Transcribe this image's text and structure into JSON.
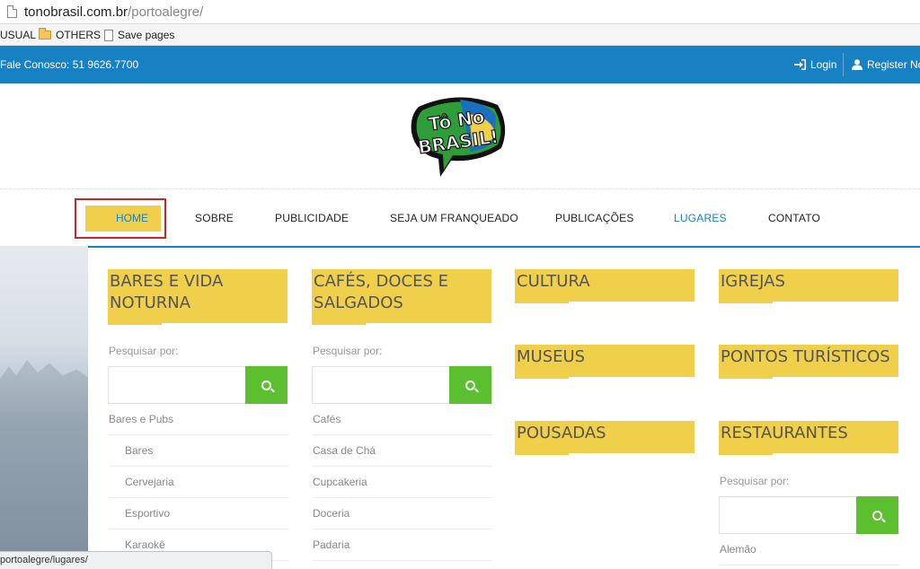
{
  "browser": {
    "url_domain": "tonobrasil.com.br",
    "url_path": "/portoalegre/",
    "bookmarks": [
      "USUAL",
      "OTHERS",
      "Save pages"
    ],
    "status_text": "portoalegre/lugares/"
  },
  "topbar": {
    "phone": "Fale Conosco: 51 9626.7700",
    "login": "Login",
    "register": "Register Now"
  },
  "logo": {
    "line1": "Tô No",
    "line2": "BRASIL!"
  },
  "nav": {
    "items": [
      "HOME",
      "SOBRE",
      "PUBLICIDADE",
      "SEJA UM FRANQUEADO",
      "PUBLICAÇÕES",
      "LUGARES",
      "CONTATO"
    ],
    "active": "LUGARES"
  },
  "mega": {
    "search_label": "Pesquisar por:",
    "col1": {
      "title_line1": "BARES E VIDA",
      "title_line2": "NOTURNA",
      "links": [
        "Bares e Pubs",
        "Bares",
        "Cervejaria",
        "Esportivo",
        "Karaokê"
      ]
    },
    "col2": {
      "title_line1": "CAFÉS, DOCES E",
      "title_line2": "SALGADOS",
      "links": [
        "Cafés",
        "Casa de Chá",
        "Cupcakeria",
        "Doceria",
        "Padaria"
      ]
    },
    "col3": [
      "CULTURA",
      "MUSEUS",
      "POUSADAS"
    ],
    "col4": {
      "titles": [
        "IGREJAS",
        "PONTOS TURÍSTICOS",
        "RESTAURANTES"
      ],
      "links": [
        "Alemão"
      ]
    }
  },
  "colors": {
    "brand_blue": "#1781c4",
    "accent_yellow": "#f0cf4a",
    "search_green": "#5bbf2f",
    "highlight_red": "#c62828"
  }
}
